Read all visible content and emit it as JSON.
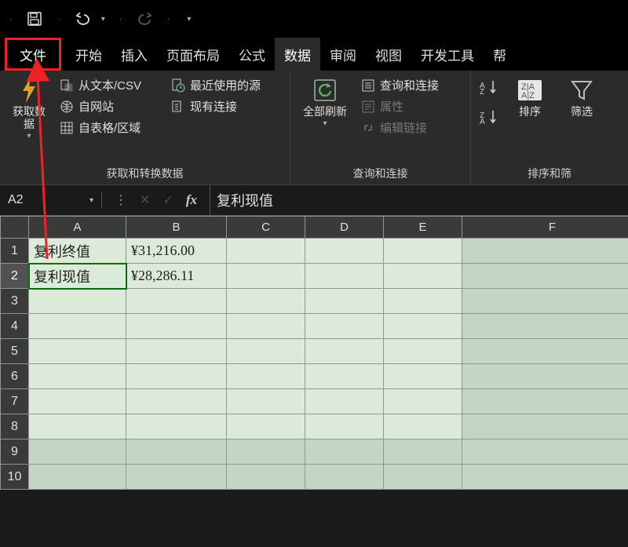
{
  "titlebar": {
    "save": "save",
    "undo": "undo",
    "redo": "redo"
  },
  "menu": {
    "file": "文件",
    "tabs": [
      "开始",
      "插入",
      "页面布局",
      "公式",
      "数据",
      "审阅",
      "视图",
      "开发工具",
      "帮"
    ]
  },
  "ribbon": {
    "group1": {
      "getData": "获取数\n据",
      "fromCsv": "从文本/CSV",
      "fromWeb": "自网站",
      "fromTable": "自表格/区域",
      "recent": "最近使用的源",
      "existing": "现有连接",
      "label": "获取和转换数据"
    },
    "group2": {
      "refreshAll": "全部刷新",
      "queries": "查询和连接",
      "properties": "属性",
      "editLinks": "编辑链接",
      "label": "查询和连接"
    },
    "group3": {
      "sort": "排序",
      "filter": "筛选",
      "label": "排序和筛"
    }
  },
  "formula": {
    "name": "A2",
    "content": "复利现值"
  },
  "grid": {
    "cols": [
      "A",
      "B",
      "C",
      "D",
      "E",
      "F"
    ],
    "rows": [
      "1",
      "2",
      "3",
      "4",
      "5",
      "6",
      "7",
      "8",
      "9",
      "10"
    ],
    "cells": {
      "A1": "复利终值",
      "B1": "¥31,216.00",
      "A2": "复利现值",
      "B2": "¥28,286.11"
    }
  }
}
